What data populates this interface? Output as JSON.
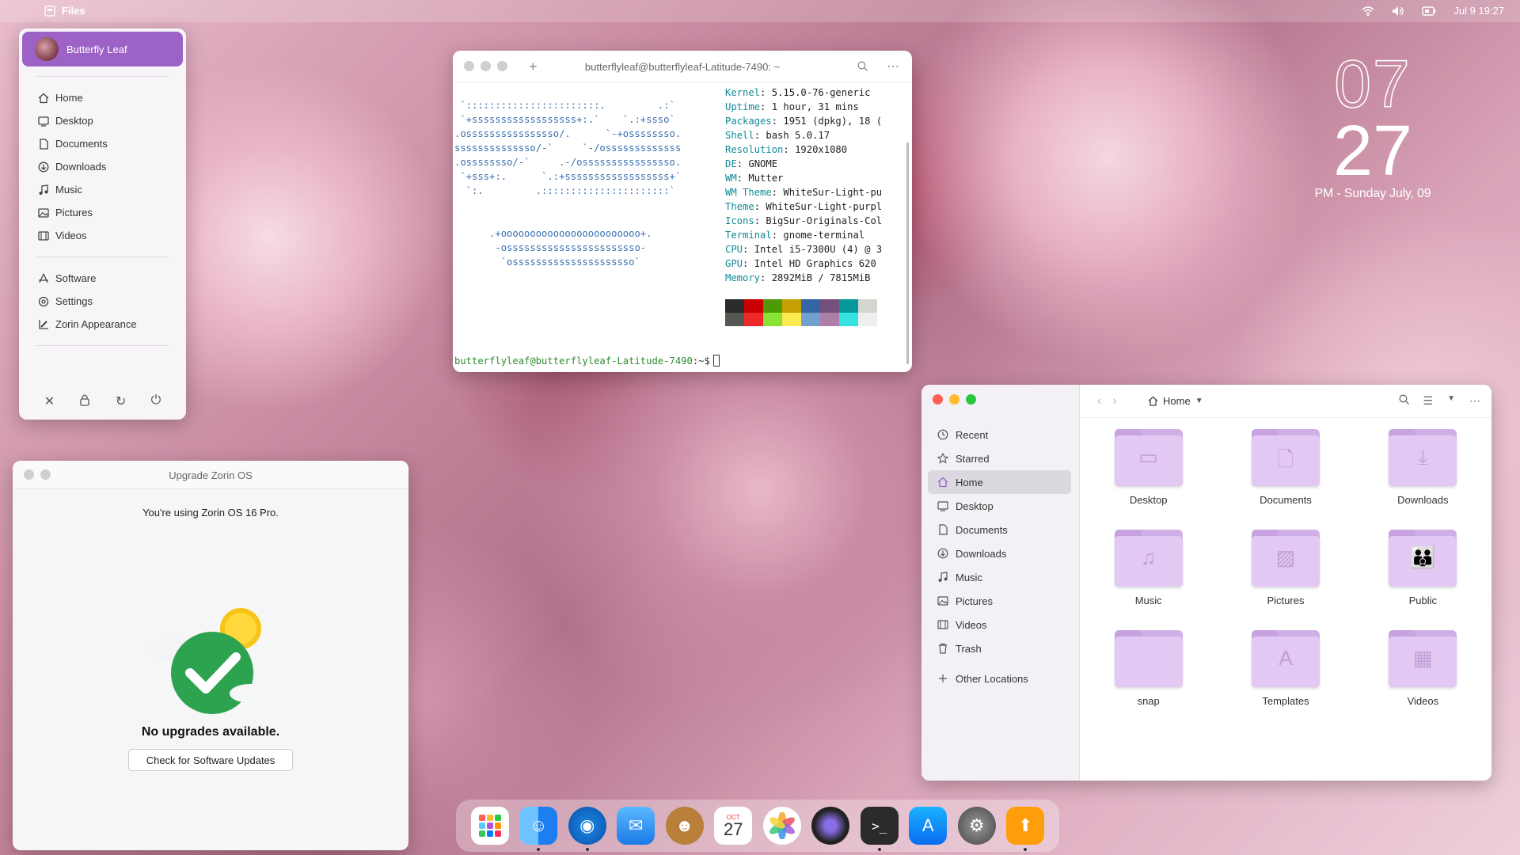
{
  "topbar": {
    "app_name": "Files",
    "datetime": "Jul 9  19:27"
  },
  "menu": {
    "user": "Butterfly Leaf",
    "places": [
      "Home",
      "Desktop",
      "Documents",
      "Downloads",
      "Music",
      "Pictures",
      "Videos"
    ],
    "apps": [
      "Software",
      "Settings",
      "Zorin Appearance"
    ],
    "power_icons": [
      "close-icon",
      "lock-icon",
      "restart-icon",
      "power-icon"
    ]
  },
  "terminal": {
    "title": "butterflyleaf@butterflyleaf-Latitude-7490: ~",
    "logo_lines": [
      " `:::::::::::::::::::::::.         .:`",
      " `+ssssssssssssssssss+:.`    `.:+ssso`",
      ".ossssssssssssssso/.      `-+ossssssso.",
      "ssssssssssssso/-`     `-/osssssssssssss",
      ".ossssssso/-`     .-/ossssssssssssssso.",
      " `+sss+:.      `.:+ssssssssssssssssss+`",
      "  `:.         .::::::::::::::::::::::`",
      "",
      "",
      "      .+oooooooooooooooooooooooo+.",
      "       -osssssssssssssssssssssso-",
      "        `osssssssssssssssssssso`"
    ],
    "info": [
      {
        "k": "Kernel",
        "v": "5.15.0-76-generic"
      },
      {
        "k": "Uptime",
        "v": "1 hour, 31 mins"
      },
      {
        "k": "Packages",
        "v": "1951 (dpkg), 18 ("
      },
      {
        "k": "Shell",
        "v": "bash 5.0.17"
      },
      {
        "k": "Resolution",
        "v": "1920x1080"
      },
      {
        "k": "DE",
        "v": "GNOME"
      },
      {
        "k": "WM",
        "v": "Mutter"
      },
      {
        "k": "WM Theme",
        "v": "WhiteSur-Light-pu"
      },
      {
        "k": "Theme",
        "v": "WhiteSur-Light-purpl"
      },
      {
        "k": "Icons",
        "v": "BigSur-Originals-Col"
      },
      {
        "k": "Terminal",
        "v": "gnome-terminal"
      },
      {
        "k": "CPU",
        "v": "Intel i5-7300U (4) @ 3"
      },
      {
        "k": "GPU",
        "v": "Intel HD Graphics 620"
      },
      {
        "k": "Memory",
        "v": "2892MiB / 7815MiB"
      }
    ],
    "swatches_top": [
      "#2b2b2b",
      "#cc0000",
      "#4e9a06",
      "#c4a000",
      "#3465a4",
      "#75507b",
      "#06989a",
      "#d3d7cf"
    ],
    "swatches_bottom": [
      "#555753",
      "#ef2929",
      "#8ae234",
      "#fce94f",
      "#729fcf",
      "#ad7fa8",
      "#34e2e2",
      "#eeeeec"
    ],
    "prompt_user": "butterflyleaf@butterflyleaf-Latitude-7490",
    "prompt_suffix": ":~$"
  },
  "upgrade": {
    "title": "Upgrade Zorin OS",
    "message": "You're using Zorin OS 16 Pro.",
    "status": "No upgrades available.",
    "button": "Check for Software Updates"
  },
  "files": {
    "sidebar": [
      "Recent",
      "Starred",
      "Home",
      "Desktop",
      "Documents",
      "Downloads",
      "Music",
      "Pictures",
      "Videos",
      "Trash"
    ],
    "other_locations": "Other Locations",
    "path": "Home",
    "folders": [
      "Desktop",
      "Documents",
      "Downloads",
      "Music",
      "Pictures",
      "Public",
      "snap",
      "Templates",
      "Videos"
    ]
  },
  "clock": {
    "hour": "07",
    "minute": "27",
    "date": "PM - Sunday July, 09"
  },
  "dock": {
    "apps": [
      "app-grid-icon",
      "finder-icon",
      "browser-icon",
      "mail-icon",
      "contacts-icon",
      "calendar-icon",
      "photos-icon",
      "screen-recorder-icon",
      "terminal-icon",
      "app-store-icon",
      "settings-icon",
      "software-updater-icon"
    ],
    "calendar_day": "27",
    "calendar_month": "OCT"
  },
  "colors": {
    "accent": "#9c62c6",
    "folder": "#e2c8f2"
  }
}
